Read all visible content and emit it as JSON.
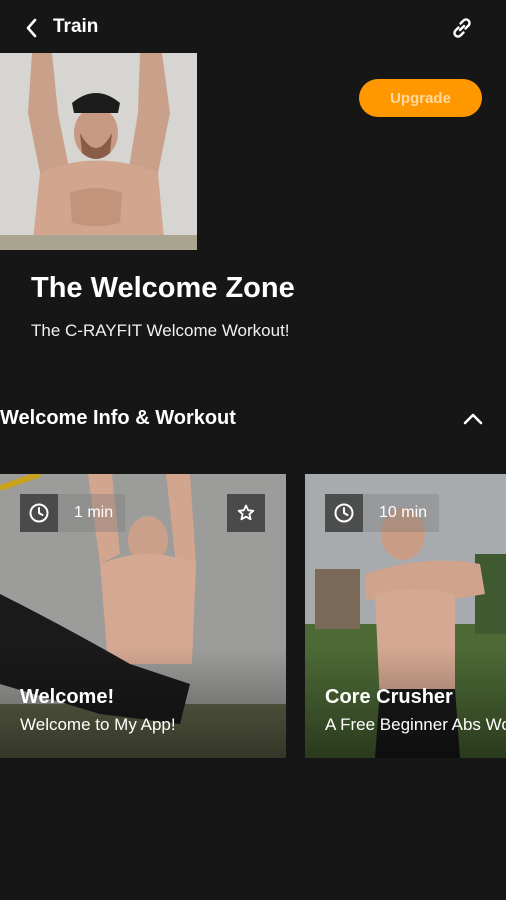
{
  "header": {
    "title": "Train",
    "back_icon": "chevron-left-icon",
    "link_icon": "link-icon"
  },
  "hero": {
    "image": "hero-photo",
    "upgrade_label": "Upgrade",
    "upgrade_color": "#ff9800",
    "title": "The Welcome Zone",
    "subtitle": "The C-RAYFIT Welcome Workout!"
  },
  "section": {
    "title": "Welcome Info & Workout",
    "toggle_icon": "chevron-up-icon"
  },
  "cards": [
    {
      "duration": "1 min",
      "title": "Welcome!",
      "description": "Welcome to My App!",
      "clock_icon": "clock-icon",
      "favorite_icon": "star-icon"
    },
    {
      "duration": "10 min",
      "title": "Core Crusher",
      "description": "A Free Beginner Abs Workout",
      "clock_icon": "clock-icon"
    }
  ]
}
